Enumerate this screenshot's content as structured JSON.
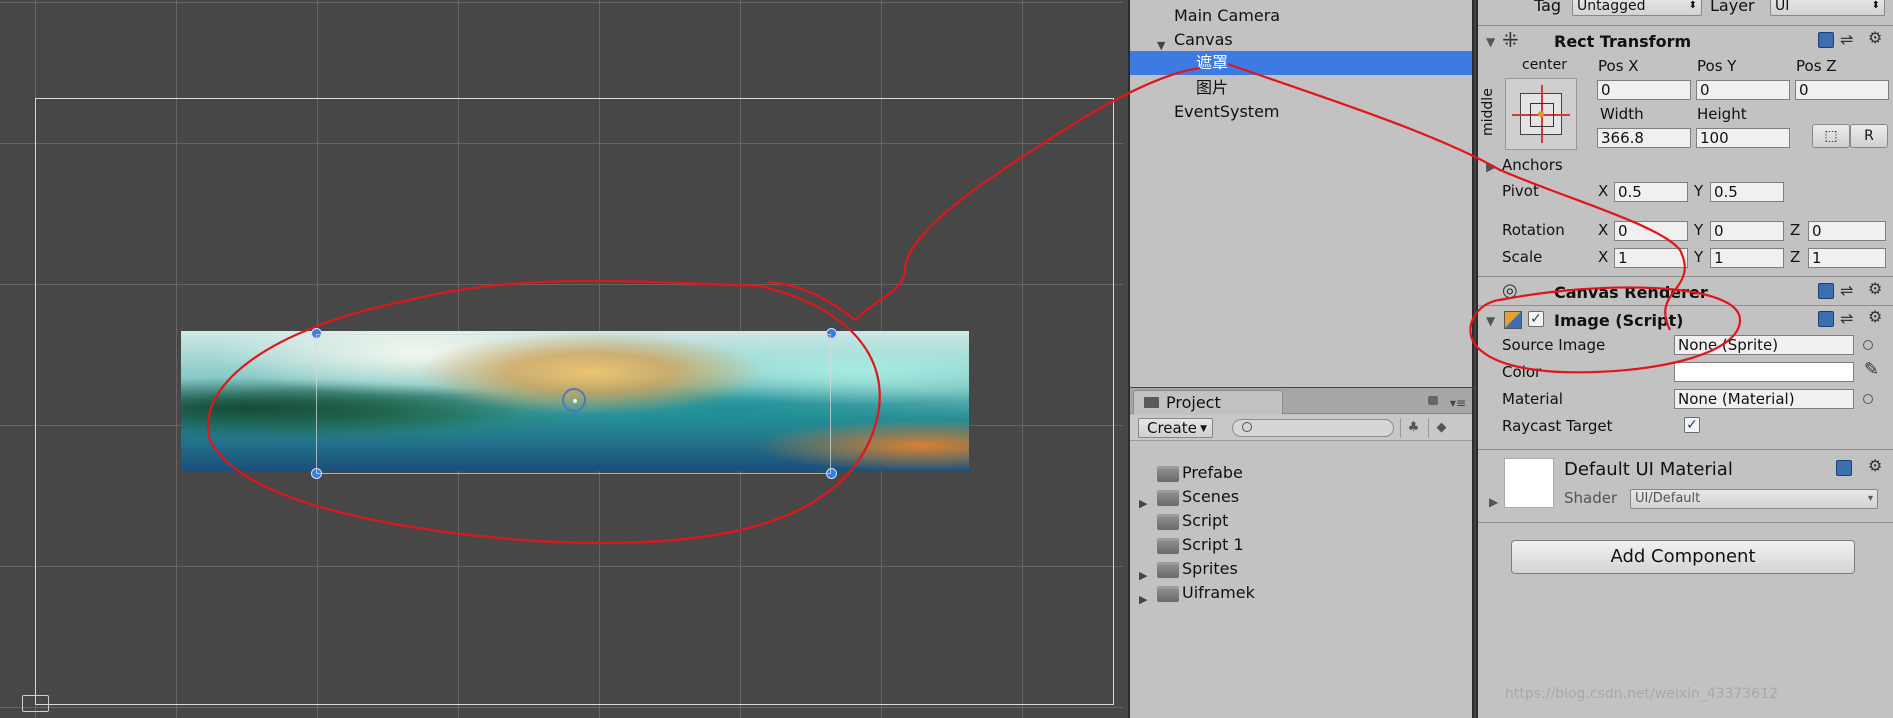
{
  "hierarchy": {
    "items": [
      {
        "label": "Main Camera",
        "indent": 1
      },
      {
        "label": "Canvas",
        "indent": 1,
        "expanded": true
      },
      {
        "label": "遮罩",
        "indent": 2,
        "selected": true
      },
      {
        "label": "图片",
        "indent": 2
      },
      {
        "label": "EventSystem",
        "indent": 1
      }
    ]
  },
  "project": {
    "tab_label": "Project",
    "create_label": "Create",
    "search_placeholder": "",
    "folders": [
      {
        "label": "Prefabe",
        "expandable": false
      },
      {
        "label": "Scenes",
        "expandable": true
      },
      {
        "label": "Script",
        "expandable": false
      },
      {
        "label": "Script 1",
        "expandable": false
      },
      {
        "label": "Sprites",
        "expandable": true
      },
      {
        "label": "Uiframek",
        "expandable": true
      }
    ]
  },
  "inspector": {
    "tag_label": "Tag",
    "tag_value": "Untagged",
    "layer_label": "Layer",
    "layer_value": "UI",
    "rect_transform": {
      "title": "Rect Transform",
      "anchor_h": "center",
      "anchor_v": "middle",
      "pos_x_label": "Pos X",
      "pos_x": "0",
      "pos_y_label": "Pos Y",
      "pos_y": "0",
      "pos_z_label": "Pos Z",
      "pos_z": "0",
      "width_label": "Width",
      "width": "366.8",
      "height_label": "Height",
      "height": "100",
      "r_button": "R",
      "anchors_label": "Anchors",
      "pivot_label": "Pivot",
      "pivot_x": "0.5",
      "pivot_y": "0.5",
      "rotation_label": "Rotation",
      "rot_x": "0",
      "rot_y": "0",
      "rot_z": "0",
      "scale_label": "Scale",
      "scale_x": "1",
      "scale_y": "1",
      "scale_z": "1",
      "x_label": "X",
      "y_label": "Y",
      "z_label": "Z"
    },
    "canvas_renderer": {
      "title": "Canvas Renderer"
    },
    "image": {
      "title": "Image (Script)",
      "enabled": true,
      "source_image_label": "Source Image",
      "source_image": "None (Sprite)",
      "color_label": "Color",
      "color_value": "#ffffff",
      "material_label": "Material",
      "material": "None (Material)",
      "raycast_label": "Raycast Target",
      "raycast": true
    },
    "material": {
      "name": "Default UI Material",
      "shader_label": "Shader",
      "shader_value": "UI/Default"
    },
    "add_component_label": "Add Component"
  },
  "scene": {
    "selection_color": "#3a7ee0"
  },
  "annotation": {
    "color": "#e0161a"
  },
  "watermark": "https://blog.csdn.net/weixin_43373612"
}
